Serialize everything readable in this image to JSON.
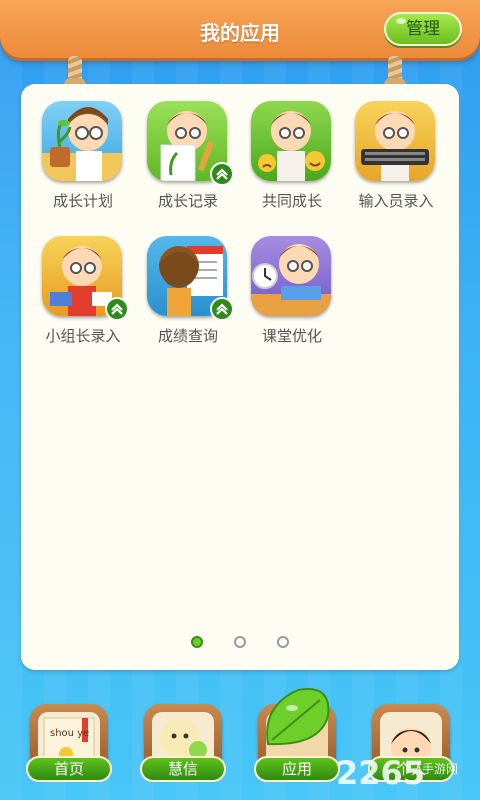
{
  "header": {
    "title": "我的应用",
    "manage_label": "管理"
  },
  "apps": [
    {
      "label": "成长计划",
      "icon": "growth-plan-icon",
      "upgrade": false
    },
    {
      "label": "成长记录",
      "icon": "growth-record-icon",
      "upgrade": true
    },
    {
      "label": "共同成长",
      "icon": "grow-together-icon",
      "upgrade": false
    },
    {
      "label": "输入员录入",
      "icon": "input-entry-icon",
      "upgrade": false
    },
    {
      "label": "小组长录入",
      "icon": "group-leader-entry-icon",
      "upgrade": true
    },
    {
      "label": "成绩查询",
      "icon": "score-query-icon",
      "upgrade": true
    },
    {
      "label": "课堂优化",
      "icon": "classroom-optimize-icon",
      "upgrade": false
    }
  ],
  "pager": {
    "pages": 3,
    "current": 1
  },
  "nav": [
    {
      "label": "首页",
      "icon": "home-book-icon",
      "icon_text": "shou ye"
    },
    {
      "label": "慧信",
      "icon": "chat-bubble-icon"
    },
    {
      "label": "应用",
      "icon": "leaf-icon"
    },
    {
      "label": "个人",
      "icon": "profile-avatar-icon"
    }
  ],
  "watermark": {
    "text": "2265",
    "subtext": "手游网"
  },
  "colors": {
    "header": "#ec8a3a",
    "accent_green": "#6dbd20",
    "background": "#3cb2f5",
    "panel": "#fefdf3"
  }
}
